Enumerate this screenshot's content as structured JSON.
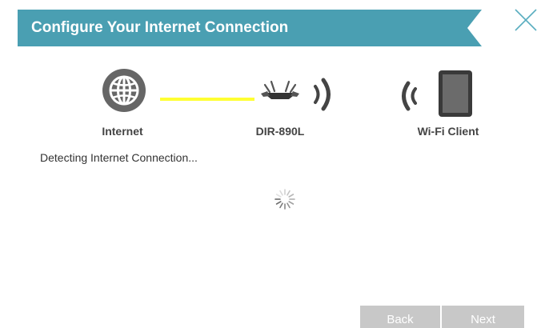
{
  "header": {
    "title": "Configure Your Internet Connection",
    "accent_color": "#4a9fb2",
    "close_icon": "close-icon"
  },
  "diagram": {
    "internet": {
      "label": "Internet",
      "icon": "globe-icon"
    },
    "router": {
      "label": "DIR-890L",
      "icon": "router-icon"
    },
    "client": {
      "label": "Wi-Fi Client",
      "icon": "tablet-icon"
    },
    "link_color": "#ffff33"
  },
  "status": {
    "message": "Detecting Internet Connection...",
    "spinner_icon": "loading-spinner-icon"
  },
  "footer": {
    "back_label": "Back",
    "next_label": "Next"
  }
}
